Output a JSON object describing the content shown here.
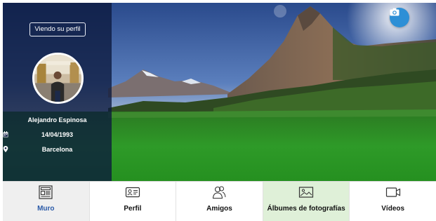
{
  "profile": {
    "view_profile_label": "Viendo su perfil",
    "name": "Alejandro Espinosa",
    "birthdate": "14/04/1993",
    "location": "Barcelona"
  },
  "cover": {
    "change_photo_icon": "camera-icon"
  },
  "tabs": [
    {
      "label": "Muro",
      "icon": "newspaper-icon",
      "state": "selected"
    },
    {
      "label": "Perfil",
      "icon": "id-card-icon"
    },
    {
      "label": "Amigos",
      "icon": "friends-icon"
    },
    {
      "label": "Álbumes de fotografías",
      "icon": "picture-icon",
      "state": "highlighted"
    },
    {
      "label": "Vídeos",
      "icon": "video-camera-icon"
    }
  ],
  "colors": {
    "side_panel": "#0c183c",
    "camera_button": "#2d8fd6",
    "tab_selected_bg": "#efefef",
    "tab_highlight_bg": "#dff0d8",
    "tab_selected_text": "#2a5aa8"
  }
}
